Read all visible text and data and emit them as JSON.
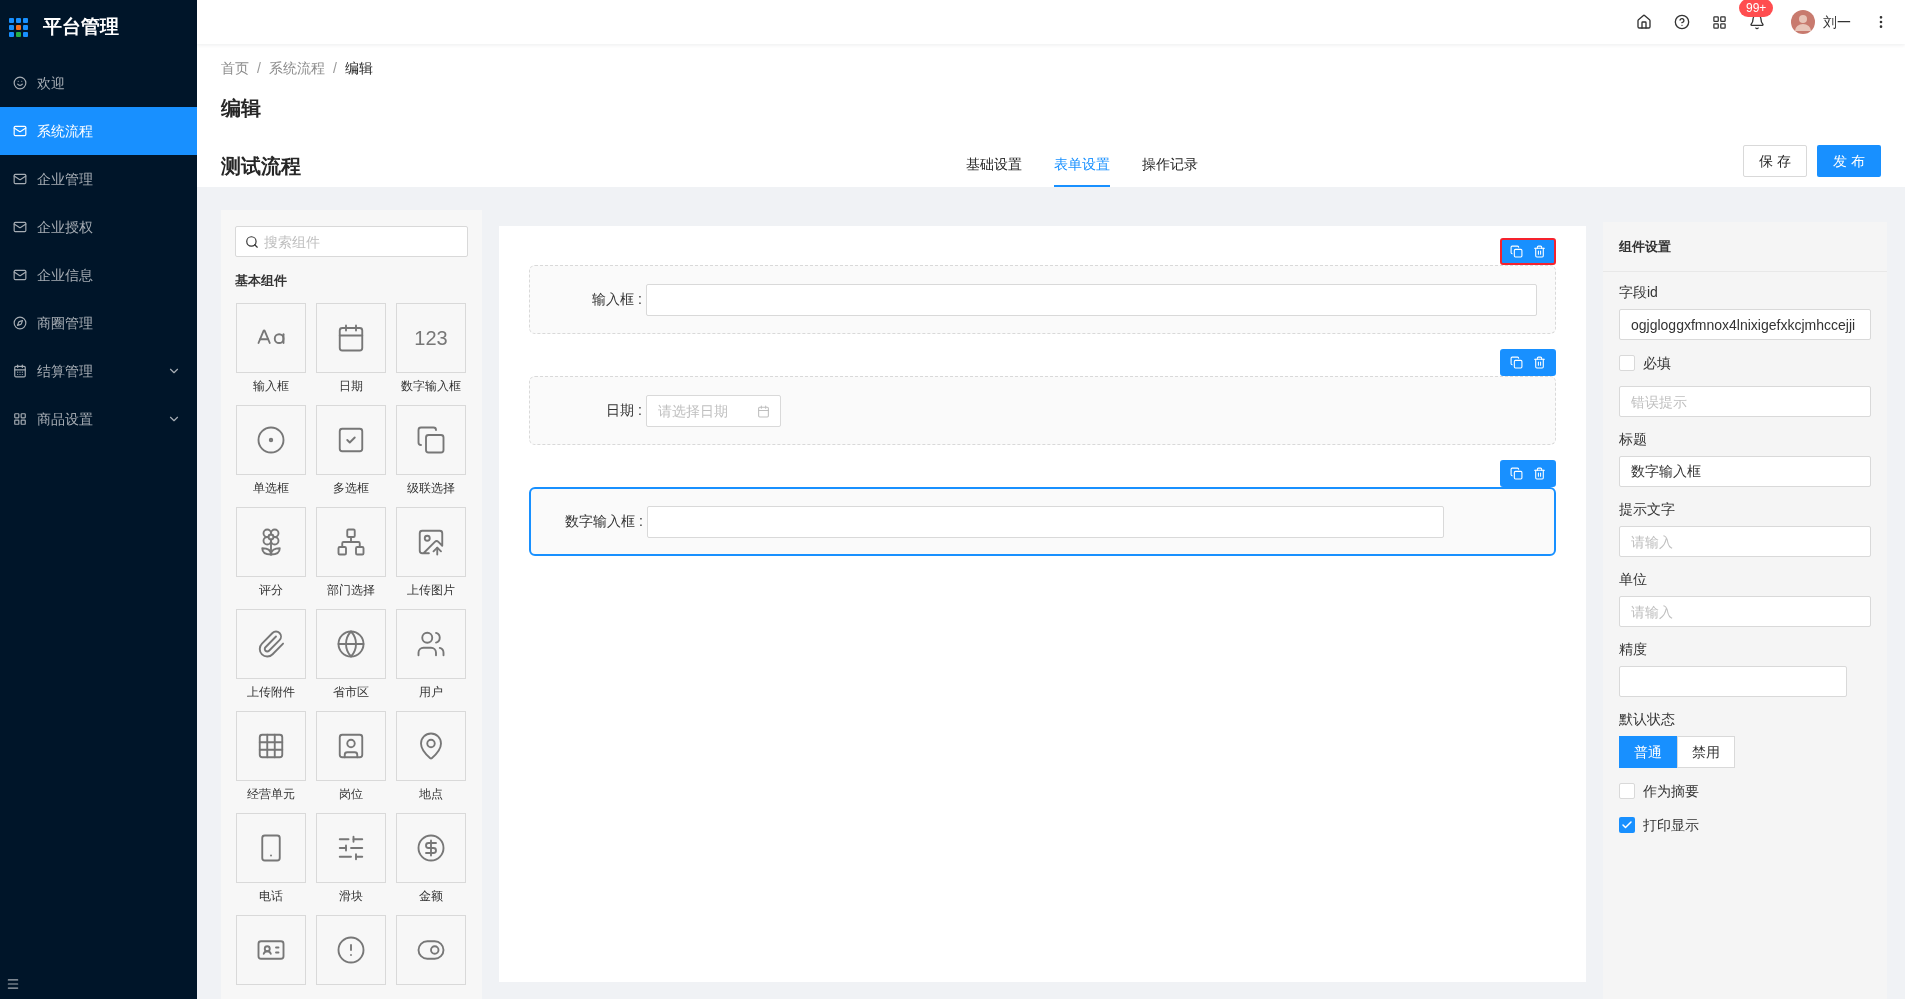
{
  "sidebar": {
    "title": "平台管理",
    "items": [
      {
        "label": "欢迎",
        "selected": false,
        "kind": "item"
      },
      {
        "label": "系统流程",
        "selected": true,
        "kind": "item"
      },
      {
        "label": "企业管理",
        "selected": false,
        "kind": "item"
      },
      {
        "label": "企业授权",
        "selected": false,
        "kind": "item"
      },
      {
        "label": "企业信息",
        "selected": false,
        "kind": "item"
      },
      {
        "label": "商圈管理",
        "selected": false,
        "kind": "item"
      },
      {
        "label": "结算管理",
        "selected": false,
        "kind": "submenu"
      },
      {
        "label": "商品设置",
        "selected": false,
        "kind": "submenu"
      }
    ]
  },
  "header": {
    "notification_badge": "99+",
    "user_name": "刘一"
  },
  "breadcrumb": [
    "首页",
    "系统流程",
    "编辑"
  ],
  "breadcrumb_separator": "/",
  "page_title": "编辑",
  "flow_name": "测试流程",
  "tabs": [
    {
      "label": "基础设置",
      "selected": false
    },
    {
      "label": "表单设置",
      "selected": true
    },
    {
      "label": "操作记录",
      "selected": false
    }
  ],
  "buttons": [
    {
      "label": "保 存",
      "kind": "default"
    },
    {
      "label": "发 布",
      "kind": "primary"
    }
  ],
  "component_panel": {
    "search_placeholder": "搜索组件",
    "group_title": "基本组件",
    "number_tile_glyph": "123",
    "components": [
      {
        "label": "输入框"
      },
      {
        "label": "日期"
      },
      {
        "label": "数字输入框"
      },
      {
        "label": "单选框"
      },
      {
        "label": "多选框"
      },
      {
        "label": "级联选择"
      },
      {
        "label": "评分"
      },
      {
        "label": "部门选择"
      },
      {
        "label": "上传图片"
      },
      {
        "label": "上传附件"
      },
      {
        "label": "省市区"
      },
      {
        "label": "用户"
      },
      {
        "label": "经营单元"
      },
      {
        "label": "岗位"
      },
      {
        "label": "地点"
      },
      {
        "label": "电话"
      },
      {
        "label": "滑块"
      },
      {
        "label": "金额"
      }
    ]
  },
  "canvas_fields": [
    {
      "label": "输入框 :",
      "kind": "text",
      "selected": false,
      "toolbar_highlighted": true
    },
    {
      "label": "日期 :",
      "kind": "date",
      "placeholder": "请选择日期",
      "selected": false,
      "toolbar_highlighted": false
    },
    {
      "label": "数字输入框 :",
      "kind": "number",
      "selected": true,
      "toolbar_highlighted": false
    }
  ],
  "settings": {
    "title": "组件设置",
    "rows": [
      {
        "kind": "input",
        "label": "字段id",
        "value": "ogjgloggxfmnox4lnixigefxkcjmhccejji"
      },
      {
        "kind": "checkbox",
        "label": "必填",
        "checked": false
      },
      {
        "kind": "input",
        "placeholder": "错误提示"
      },
      {
        "kind": "input",
        "label": "标题",
        "value": "数字输入框"
      },
      {
        "kind": "input",
        "label": "提示文字",
        "placeholder": "请输入"
      },
      {
        "kind": "input",
        "label": "单位",
        "placeholder": "请输入"
      },
      {
        "kind": "number",
        "label": "精度"
      },
      {
        "kind": "segmented",
        "label": "默认状态",
        "options": [
          {
            "label": "普通",
            "selected": true
          },
          {
            "label": "禁用",
            "selected": false
          }
        ]
      },
      {
        "kind": "checkbox",
        "label": "作为摘要",
        "checked": false
      },
      {
        "kind": "checkbox",
        "label": "打印显示",
        "checked": true
      }
    ]
  }
}
